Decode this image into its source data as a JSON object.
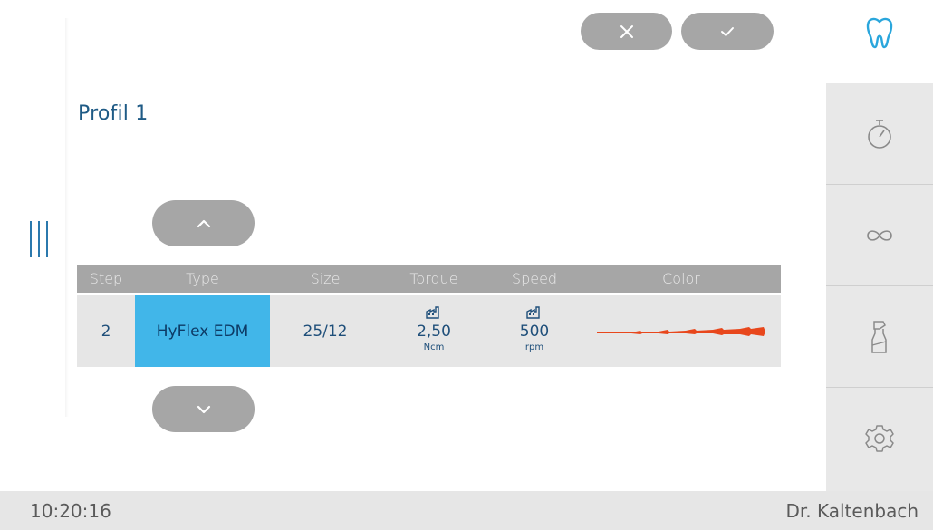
{
  "header": {
    "cancel_icon": "close-icon",
    "confirm_icon": "check-icon"
  },
  "profile": {
    "title": "Profil 1"
  },
  "table": {
    "columns": [
      "Step",
      "Type",
      "Size",
      "Torque",
      "Speed",
      "Color"
    ],
    "rows": [
      {
        "step": "2",
        "type": "HyFlex EDM",
        "size": "25/12",
        "torque_value": "2,50",
        "torque_unit": "Ncm",
        "speed_value": "500",
        "speed_unit": "rpm",
        "file_color": "#e8471c"
      }
    ]
  },
  "sidebar": {
    "items": [
      {
        "icon": "tooth-icon",
        "color": "#2aa6dc"
      },
      {
        "icon": "stopwatch-icon"
      },
      {
        "icon": "infinity-icon"
      },
      {
        "icon": "spray-bottle-icon"
      },
      {
        "icon": "gear-icon"
      }
    ]
  },
  "status_bar": {
    "time": "10:20:16",
    "user": "Dr. Kaltenbach"
  },
  "colors": {
    "accent_blue": "#41b6e9",
    "title_blue": "#1f5b86",
    "button_gray": "#a6a6a6"
  }
}
